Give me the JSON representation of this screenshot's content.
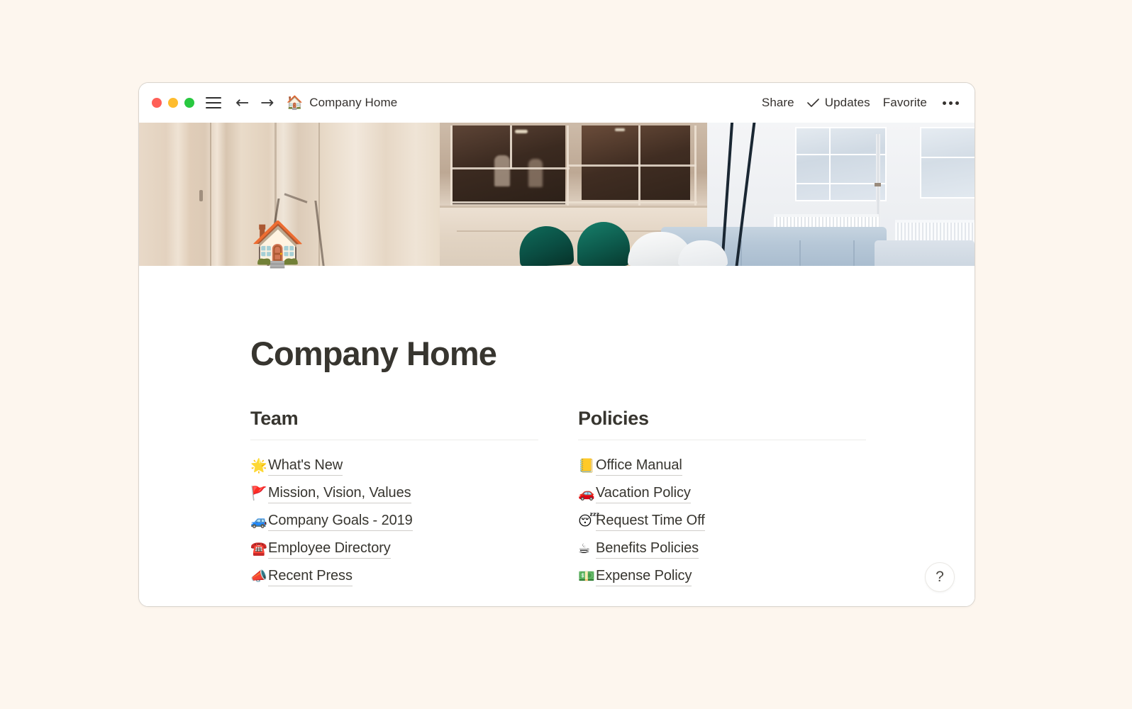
{
  "window": {
    "traffic_lights": [
      {
        "name": "close",
        "color": "#FF5F57"
      },
      {
        "name": "minimize",
        "color": "#FEBC2E"
      },
      {
        "name": "maximize",
        "color": "#28C840"
      }
    ],
    "menu_icon": "hamburger-menu-icon",
    "back_arrow": "←",
    "forward_arrow": "→",
    "breadcrumb_emoji": "🏠",
    "breadcrumb_title": "Company Home",
    "actions": {
      "share": "Share",
      "updates": "Updates",
      "updates_icon": "check-icon",
      "favorite": "Favorite",
      "more": "more-options-icon"
    }
  },
  "cover": {
    "name": "cover-photo",
    "description": "office interior"
  },
  "page": {
    "emoji": "🏠",
    "title": "Company Home",
    "help_label": "?"
  },
  "columns": [
    {
      "heading": "Team",
      "links": [
        {
          "emoji": "🌟",
          "label": "What's New"
        },
        {
          "emoji": "🚩",
          "label": "Mission, Vision, Values"
        },
        {
          "emoji": "🚙",
          "label": "Company Goals - 2019"
        },
        {
          "emoji": "☎️",
          "label": "Employee Directory"
        },
        {
          "emoji": "📣",
          "label": "Recent Press"
        }
      ]
    },
    {
      "heading": "Policies",
      "links": [
        {
          "emoji": "📒",
          "label": "Office Manual"
        },
        {
          "emoji": "🚗",
          "label": "Vacation Policy"
        },
        {
          "emoji": "😴",
          "label": "Request Time Off"
        },
        {
          "emoji": "☕",
          "label": "Benefits Policies"
        },
        {
          "emoji": "💵",
          "label": "Expense Policy"
        }
      ]
    }
  ],
  "colors": {
    "desktop_background": "#FDF6EE",
    "window_background": "#FFFFFF",
    "text_primary": "#37352F",
    "divider": "#ECECEA"
  }
}
